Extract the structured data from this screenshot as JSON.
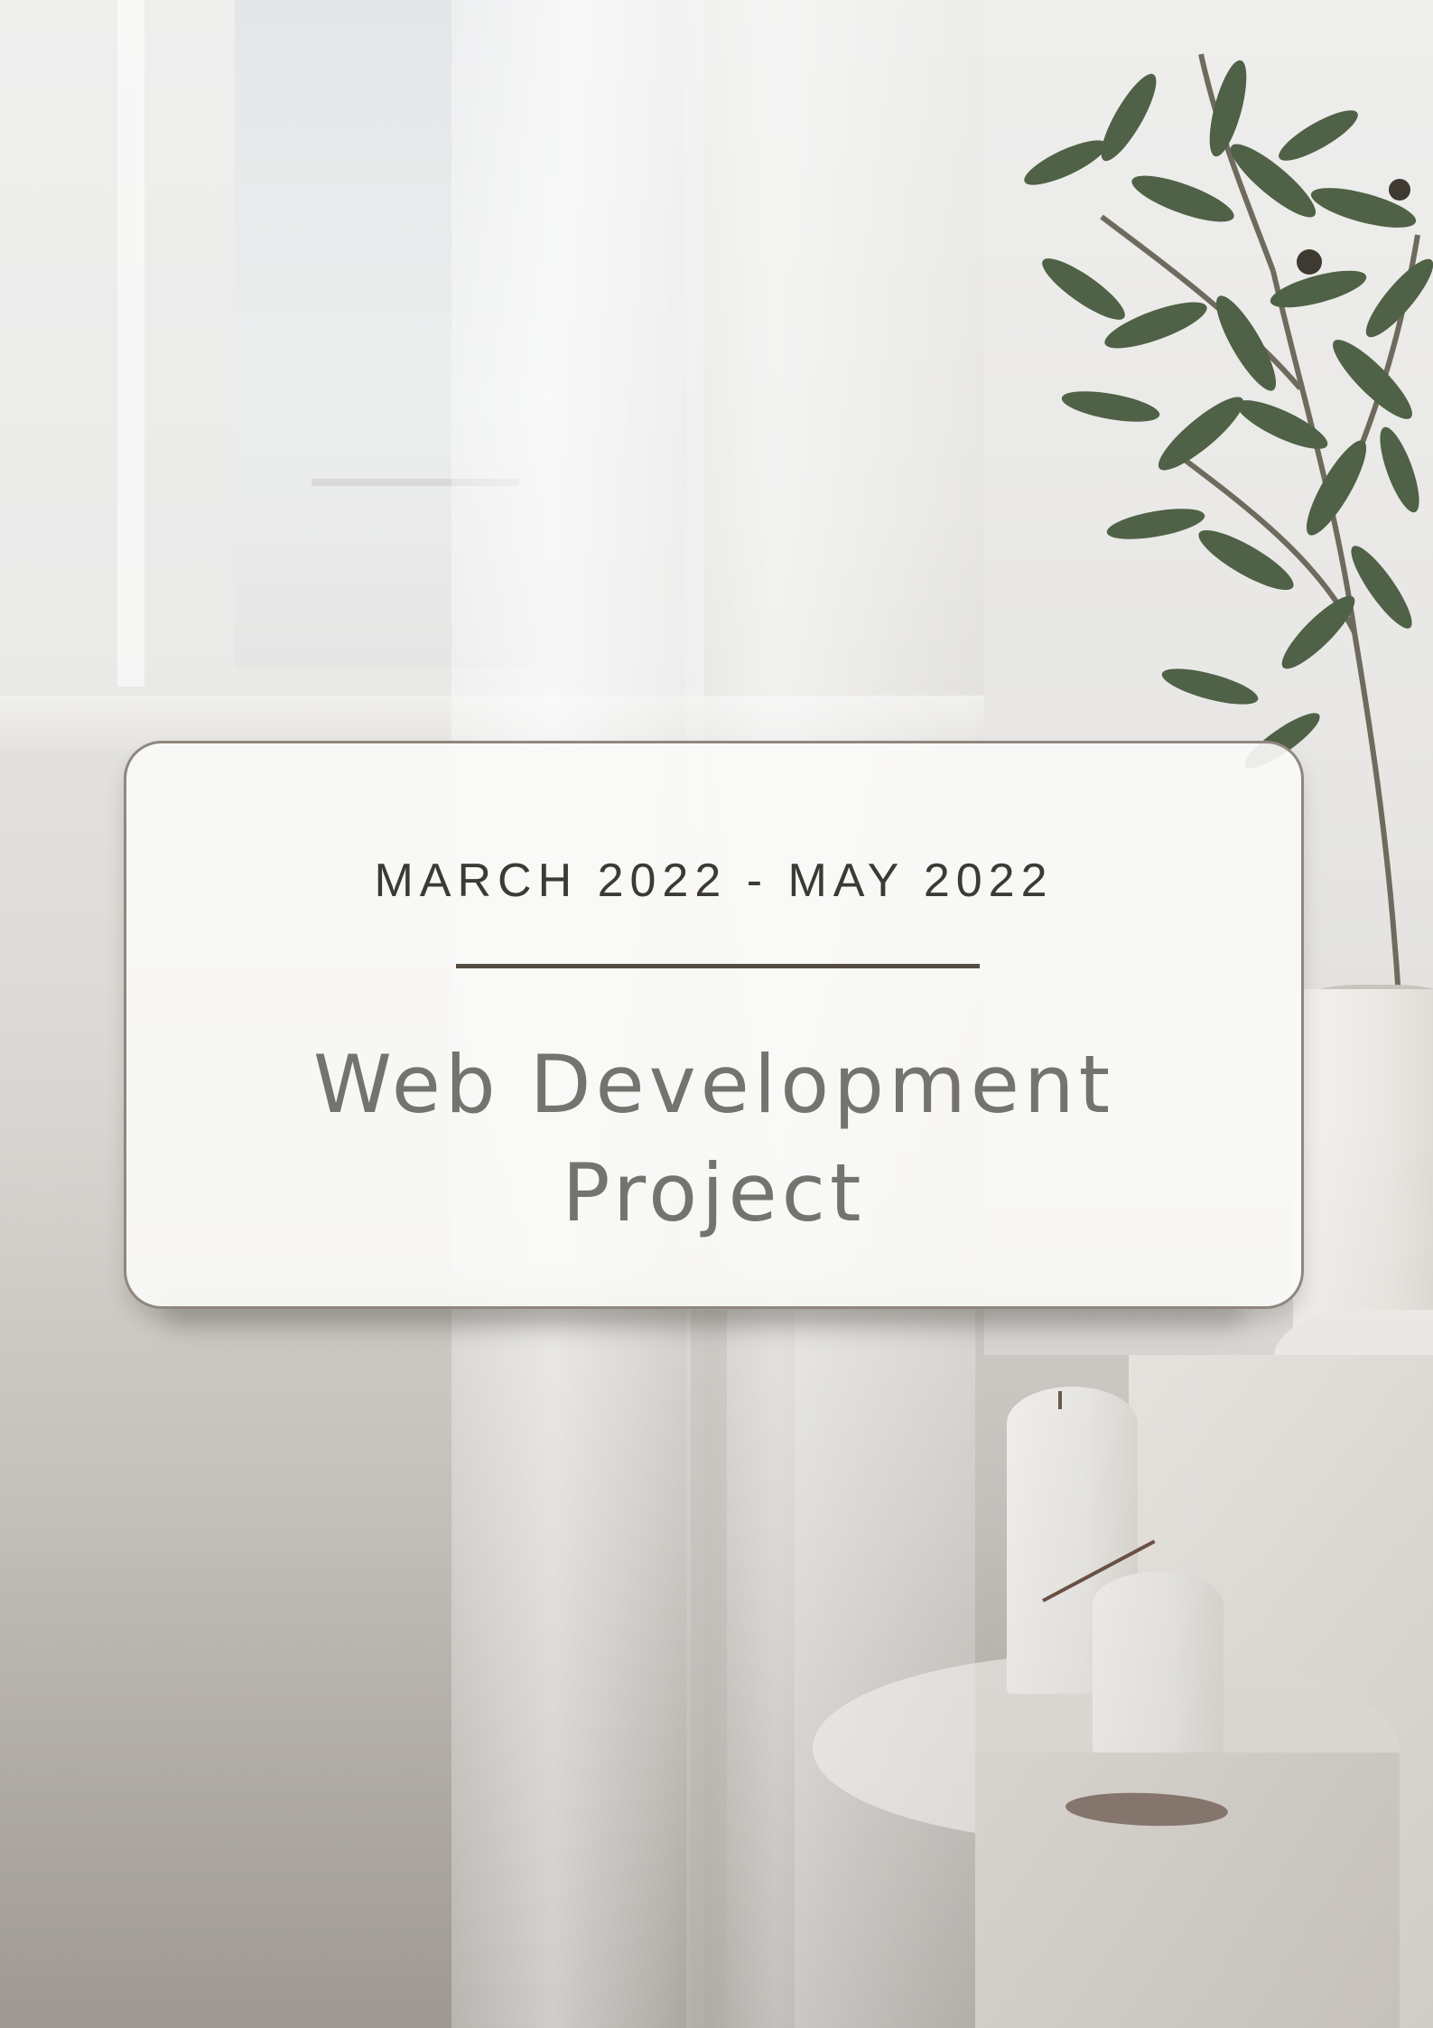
{
  "cover": {
    "date_range": "MARCH 2022 - MAY 2022",
    "title_line1": "Web Development",
    "title_line2": "Project"
  },
  "colors": {
    "text_dark": "#3c3a37",
    "title_gray": "#757370",
    "rule": "#554c43",
    "card_border": "#8f877f",
    "card_fill": "#fafaf9",
    "leaf_green": "#4f6146"
  },
  "background": {
    "scene": "sheer-curtain-plant-candles",
    "icons": [
      "olive-plant-icon",
      "candle-icon",
      "incense-icon"
    ]
  }
}
